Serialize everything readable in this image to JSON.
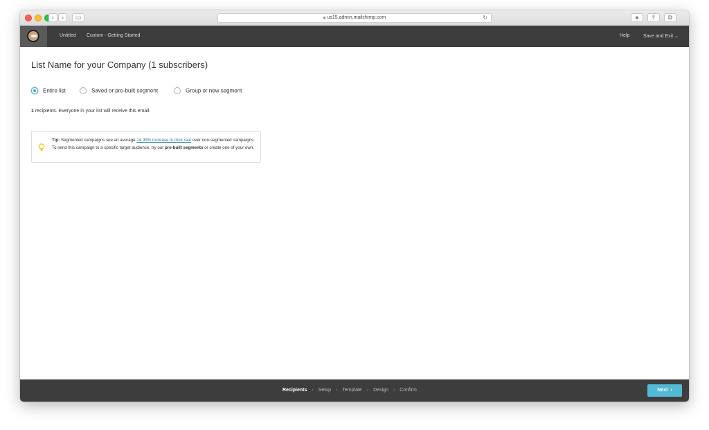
{
  "browser": {
    "url": "us15.admin.mailchimp.com",
    "back_icon": "chevron-left",
    "forward_icon": "chevron-right"
  },
  "header": {
    "campaign_name": "Untitled",
    "template_name": "Custom - Getting Started",
    "help_label": "Help",
    "save_exit_label": "Save and Exit",
    "save_exit_caret": "⌄"
  },
  "main": {
    "title": "List Name for your Company (1 subscribers)",
    "options": [
      {
        "label": "Entire list",
        "checked": true
      },
      {
        "label": "Saved or pre-built segment",
        "checked": false
      },
      {
        "label": "Group or new segment",
        "checked": false
      }
    ],
    "recipients_count": "1",
    "recipients_text": " recipients. Everyone in your list will receive this email.",
    "tip": {
      "prefix": "Tip:",
      "text1": " Segmented campaigns see an average ",
      "link": "14.99% increase in click rate",
      "text2": " over non-segmented campaigns. To send this campaign to a specific target audience, try our ",
      "bold": "pre-built segments",
      "text3": " or create one of your own."
    }
  },
  "footer": {
    "steps": [
      "Recipients",
      "Setup",
      "Template",
      "Design",
      "Confirm"
    ],
    "active_step": "Recipients",
    "next_label": "Next",
    "next_arrow": "›"
  },
  "colors": {
    "header_bg": "#3d3d3d",
    "accent": "#52bad5",
    "link": "#2c7fa8",
    "radio_accent": "#4aa3c6"
  }
}
